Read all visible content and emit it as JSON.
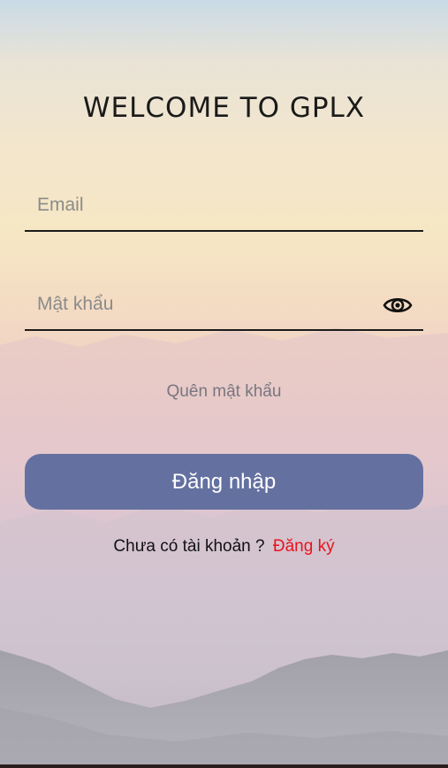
{
  "header": {
    "title": "WELCOME TO GPLX"
  },
  "form": {
    "email": {
      "placeholder": "Email",
      "value": ""
    },
    "password": {
      "placeholder": "Mật khẩu",
      "value": ""
    },
    "forgot_label": "Quên mật khẩu",
    "login_label": "Đăng nhập"
  },
  "signup": {
    "prompt": "Chưa có tài khoản ?",
    "link_label": "Đăng ký"
  },
  "icons": {
    "password_toggle": "eye-icon"
  },
  "colors": {
    "button": "#6470a0",
    "button_text": "#ffffff",
    "link": "#e8141c",
    "muted": "#77777f",
    "underline": "#1b1b1b"
  }
}
